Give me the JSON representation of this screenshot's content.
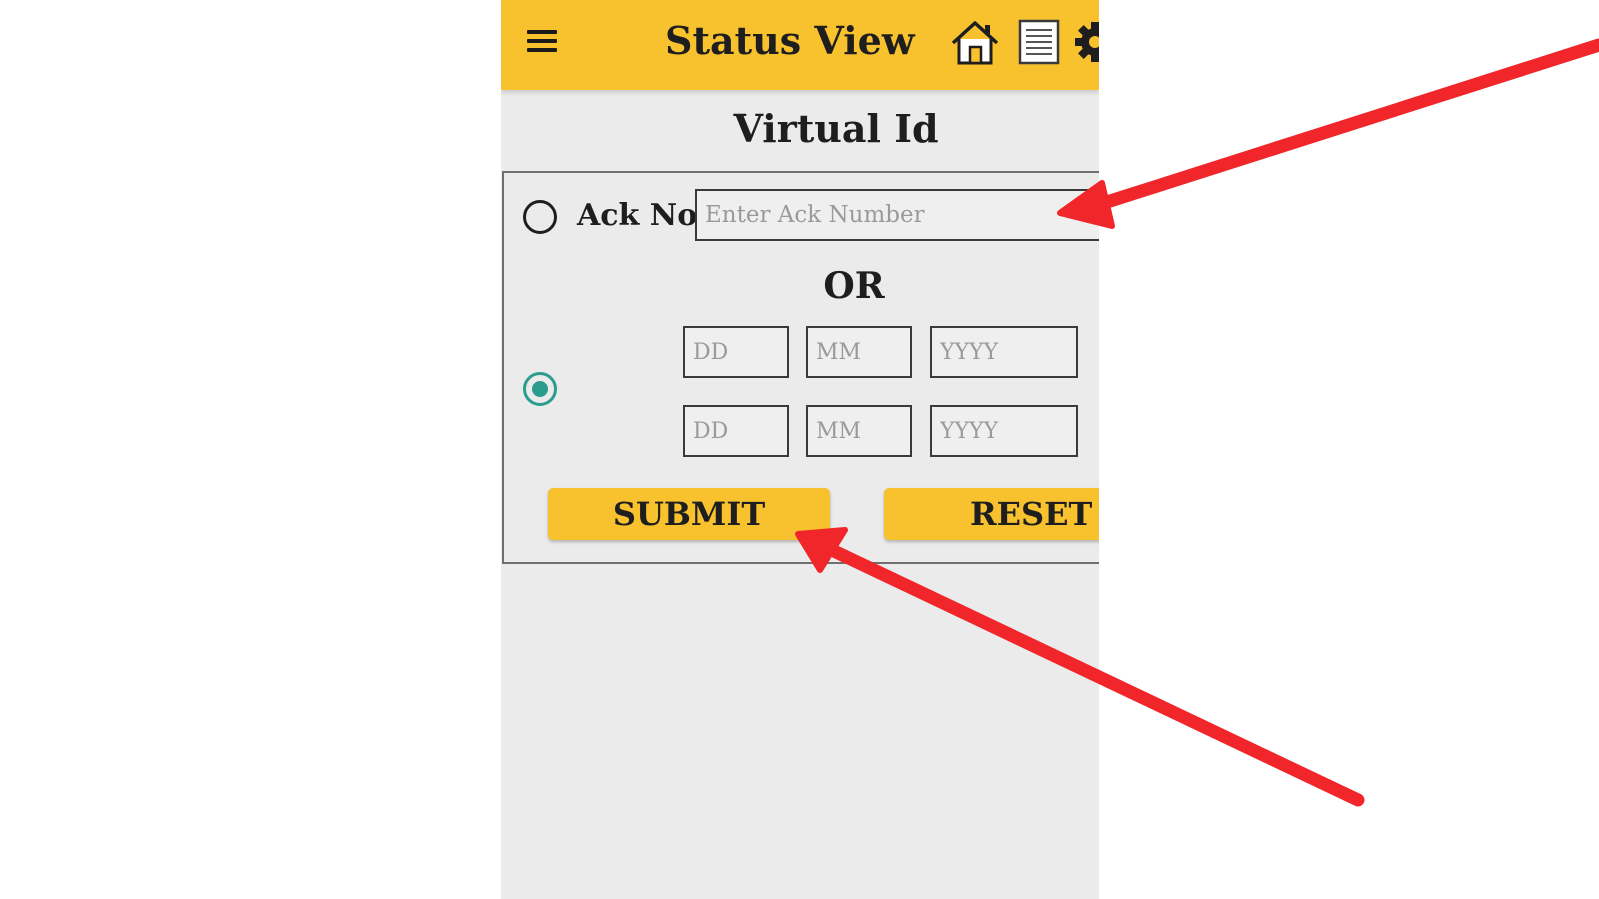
{
  "header": {
    "title": "Status View",
    "icons": [
      "menu-icon",
      "home-icon",
      "document-icon",
      "gear-icon"
    ],
    "background": "#f8c12e"
  },
  "subtitle": "Virtual Id",
  "form": {
    "ack_label": "Ack No",
    "ack_placeholder": "Enter Ack Number",
    "ack_selected": false,
    "date_selected": true,
    "or_text": "OR",
    "date_rows": [
      {
        "day_placeholder": "DD",
        "month_placeholder": "MM",
        "year_placeholder": "YYYY"
      },
      {
        "day_placeholder": "DD",
        "month_placeholder": "MM",
        "year_placeholder": "YYYY"
      }
    ],
    "submit_label": "SUBMIT",
    "reset_label": "RESET"
  },
  "colors": {
    "accent": "#f8c12e",
    "radio_selected": "#2a9d8f",
    "annotation_arrow": "#f0262a"
  }
}
